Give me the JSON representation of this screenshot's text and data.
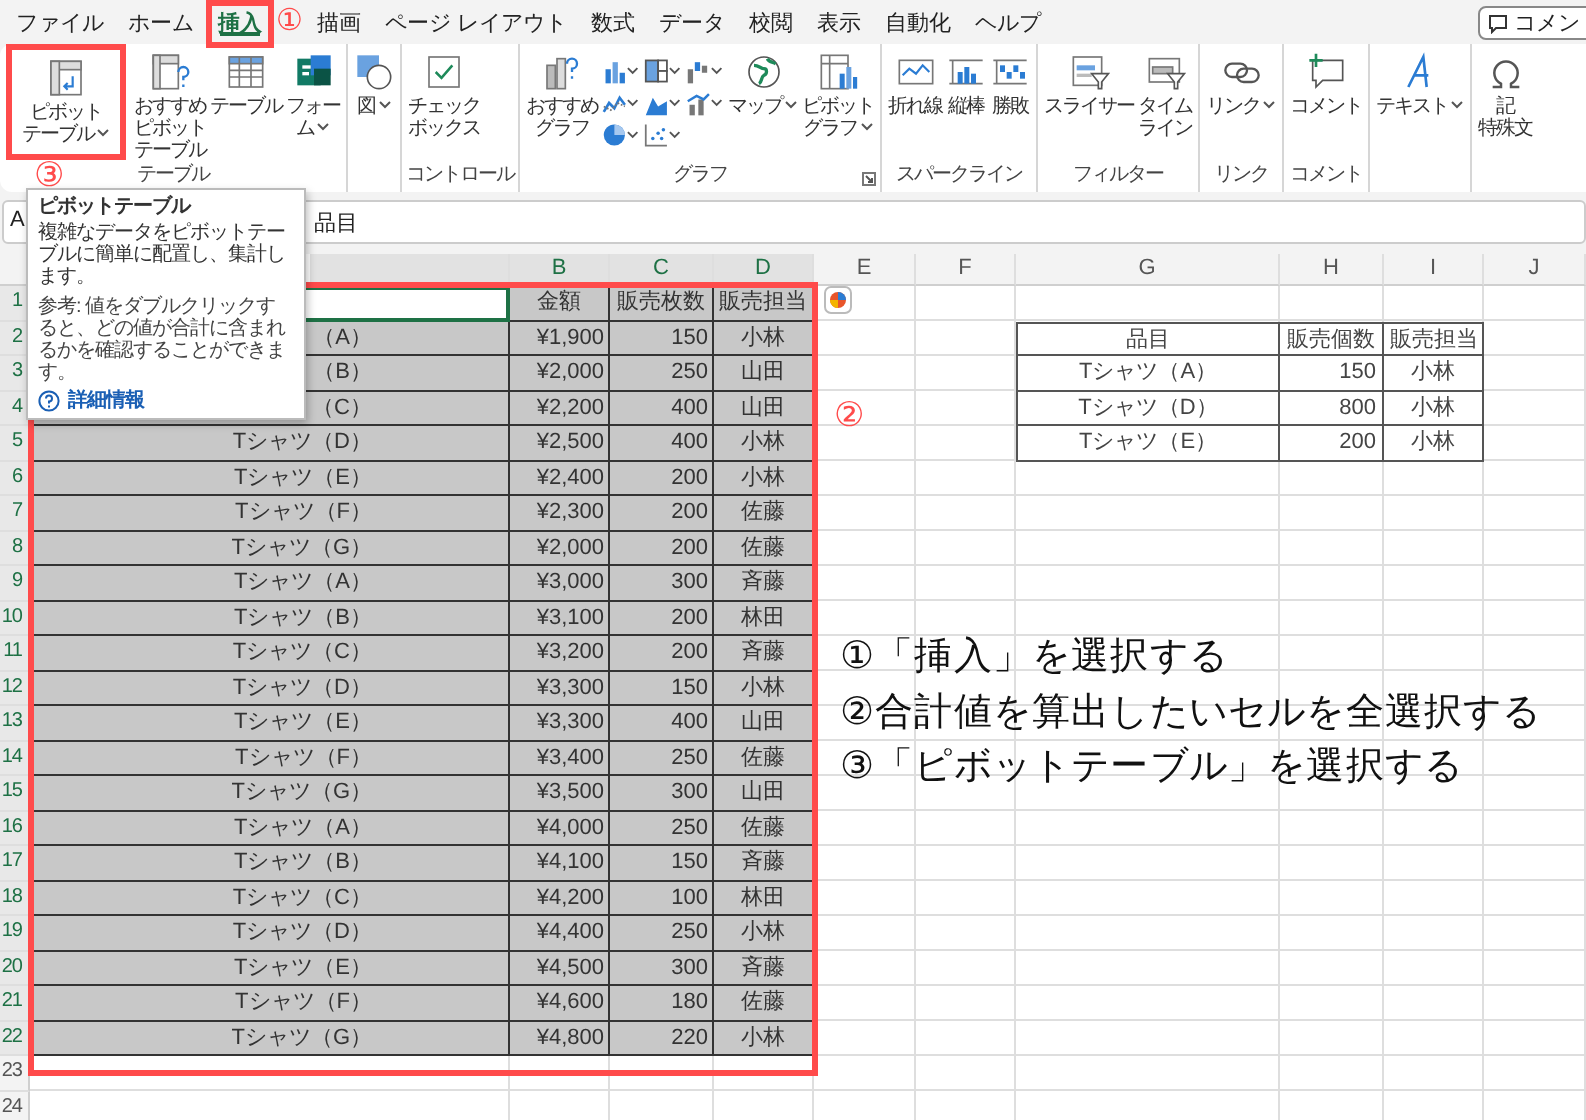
{
  "menu_tabs": [
    {
      "label": "ファイル",
      "selected": false
    },
    {
      "label": "ホーム",
      "selected": false
    },
    {
      "label": "挿入",
      "selected": true
    },
    {
      "label": "描画",
      "selected": false
    },
    {
      "label": "ページ レイアウト",
      "selected": false
    },
    {
      "label": "数式",
      "selected": false
    },
    {
      "label": "データ",
      "selected": false
    },
    {
      "label": "校閲",
      "selected": false
    },
    {
      "label": "表示",
      "selected": false
    },
    {
      "label": "自動化",
      "selected": false
    },
    {
      "label": "ヘルプ",
      "selected": false
    }
  ],
  "comment_button": {
    "label": "コメン"
  },
  "ribbon_groups": [
    {
      "label": "テーブル",
      "launcher": false,
      "buttons": [
        {
          "kind": "large",
          "lines": [
            "ピボット",
            "テーブル"
          ],
          "dropdown": true
        },
        {
          "kind": "large",
          "lines": [
            "おすすめ",
            "ピボット",
            "テーブル"
          ],
          "dropdown": false
        },
        {
          "kind": "large",
          "lines": [
            "テーブル"
          ],
          "dropdown": false
        },
        {
          "kind": "large",
          "lines": [
            "フォー",
            "ム"
          ],
          "dropdown": true
        }
      ]
    },
    {
      "launcher": false,
      "buttons": [
        {
          "kind": "large",
          "lines": [
            "図"
          ],
          "dropdown": true
        }
      ]
    },
    {
      "label": "コントロール",
      "launcher": false,
      "buttons": [
        {
          "kind": "large",
          "lines": [
            "チェック",
            "ボックス"
          ],
          "dropdown": false
        }
      ]
    },
    {
      "label": "グラフ",
      "launcher": true,
      "buttons": [
        {
          "kind": "large",
          "lines": [
            "おすすめ",
            "グラフ"
          ],
          "dropdown": false
        },
        {
          "kind": "chart-grid"
        },
        {
          "kind": "large",
          "lines": [
            "マップ"
          ],
          "dropdown": true
        },
        {
          "kind": "large",
          "lines": [
            "ピボット",
            "グラフ"
          ],
          "dropdown": true
        }
      ]
    },
    {
      "label": "スパークライン",
      "launcher": false,
      "buttons": [
        {
          "kind": "large",
          "lines": [
            "折れ線"
          ],
          "dropdown": false
        },
        {
          "kind": "large",
          "lines": [
            "縦棒"
          ],
          "dropdown": false
        },
        {
          "kind": "large",
          "lines": [
            "勝敗"
          ],
          "dropdown": false
        }
      ]
    },
    {
      "label": "フィルター",
      "launcher": false,
      "buttons": [
        {
          "kind": "large",
          "lines": [
            "スライサー"
          ],
          "dropdown": false
        },
        {
          "kind": "large",
          "lines": [
            "タイム",
            "ライン"
          ],
          "dropdown": false
        }
      ]
    },
    {
      "label": "リンク",
      "launcher": false,
      "buttons": [
        {
          "kind": "large",
          "lines": [
            "リンク"
          ],
          "dropdown": true
        }
      ]
    },
    {
      "label": "コメント",
      "launcher": false,
      "buttons": [
        {
          "kind": "large",
          "lines": [
            "コメント"
          ],
          "dropdown": false
        }
      ]
    },
    {
      "launcher": false,
      "buttons": [
        {
          "kind": "large",
          "lines": [
            "テキスト"
          ],
          "dropdown": true
        }
      ]
    },
    {
      "launcher": false,
      "buttons": [
        {
          "kind": "large",
          "lines": [
            "記",
            "特殊文"
          ],
          "dropdown": false
        }
      ]
    }
  ],
  "formula_bar": {
    "name_box": "A",
    "formula": "品目"
  },
  "tooltip": {
    "title": "ピボットテーブル",
    "description": "複雑なデータをピボットテーブルに簡単に配置し、集計します。",
    "note": "参考: 値をダブルクリックすると、どの値が合計に含まれるかを確認することができます。",
    "link": "詳細情報"
  },
  "sheet": {
    "column_letters": [
      "B",
      "C",
      "D",
      "E",
      "F",
      "G",
      "H",
      "I",
      "J"
    ],
    "row_numbers": [
      "1",
      "2",
      "3",
      "4",
      "5",
      "6",
      "7",
      "8",
      "9",
      "10",
      "11",
      "12",
      "13",
      "14",
      "15",
      "16",
      "17",
      "18",
      "19",
      "20",
      "21",
      "22",
      "23",
      "24"
    ],
    "data_table": {
      "selected": true,
      "header": [
        "金額",
        "販売枚数",
        "販売担当"
      ],
      "rows": [
        [
          "（A）",
          "¥1,900",
          "150",
          "小林"
        ],
        [
          "（B）",
          "¥2,000",
          "250",
          "山田"
        ],
        [
          "（C）",
          "¥2,200",
          "400",
          "山田"
        ],
        [
          "Tシャツ（D）",
          "¥2,500",
          "400",
          "小林"
        ],
        [
          "Tシャツ（E）",
          "¥2,400",
          "200",
          "小林"
        ],
        [
          "Tシャツ（F）",
          "¥2,300",
          "200",
          "佐藤"
        ],
        [
          "Tシャツ（G）",
          "¥2,000",
          "200",
          "佐藤"
        ],
        [
          "Tシャツ（A）",
          "¥3,000",
          "300",
          "斉藤"
        ],
        [
          "Tシャツ（B）",
          "¥3,100",
          "200",
          "林田"
        ],
        [
          "Tシャツ（C）",
          "¥3,200",
          "200",
          "斉藤"
        ],
        [
          "Tシャツ（D）",
          "¥3,300",
          "150",
          "小林"
        ],
        [
          "Tシャツ（E）",
          "¥3,300",
          "400",
          "山田"
        ],
        [
          "Tシャツ（F）",
          "¥3,400",
          "250",
          "佐藤"
        ],
        [
          "Tシャツ（G）",
          "¥3,500",
          "300",
          "山田"
        ],
        [
          "Tシャツ（A）",
          "¥4,000",
          "250",
          "佐藤"
        ],
        [
          "Tシャツ（B）",
          "¥4,100",
          "150",
          "斉藤"
        ],
        [
          "Tシャツ（C）",
          "¥4,200",
          "100",
          "林田"
        ],
        [
          "Tシャツ（D）",
          "¥4,400",
          "250",
          "小林"
        ],
        [
          "Tシャツ（E）",
          "¥4,500",
          "300",
          "斉藤"
        ],
        [
          "Tシャツ（F）",
          "¥4,600",
          "180",
          "佐藤"
        ],
        [
          "Tシャツ（G）",
          "¥4,800",
          "220",
          "小林"
        ]
      ]
    },
    "summary_table": {
      "header": [
        "品目",
        "販売個数",
        "販売担当"
      ],
      "rows": [
        [
          "Tシャツ（A）",
          "150",
          "小林"
        ],
        [
          "Tシャツ（D）",
          "800",
          "小林"
        ],
        [
          "Tシャツ（E）",
          "200",
          "小林"
        ]
      ]
    }
  },
  "annotations": {
    "markers": [
      "①",
      "②",
      "③"
    ],
    "instructions": [
      "①「挿入」を選択する",
      "②合計値を算出したいセルを全選択する",
      "③「ピボットテーブル」を選択する"
    ]
  }
}
